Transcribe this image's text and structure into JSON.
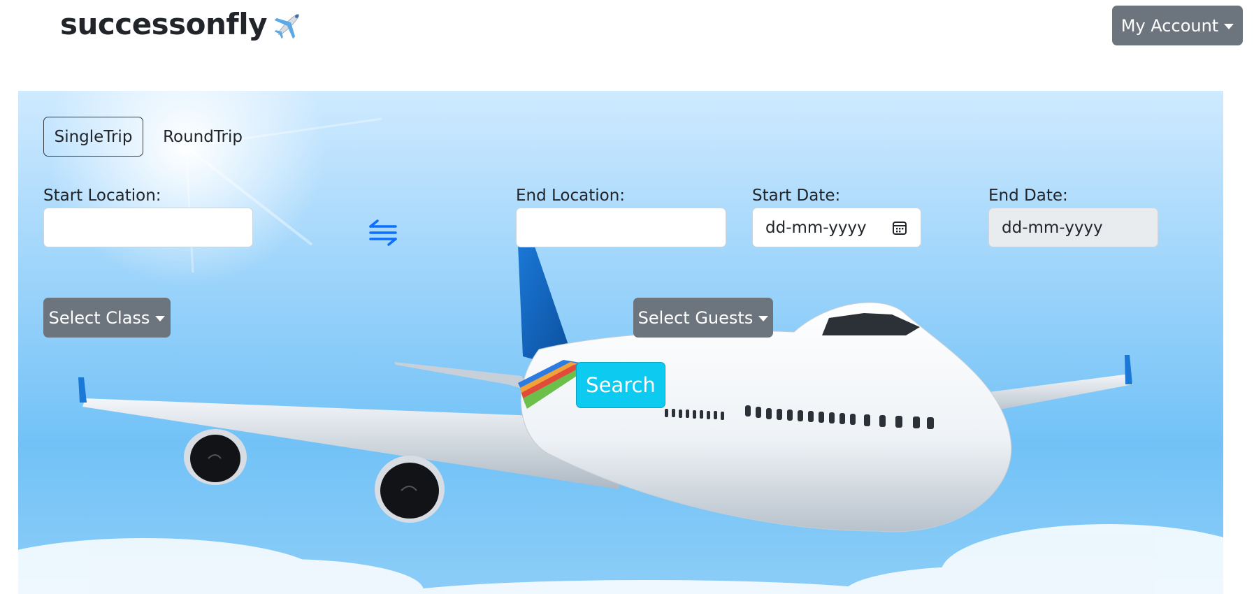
{
  "header": {
    "brand": "successonfly",
    "brand_icon": "airplane-icon",
    "account_label": "My Account"
  },
  "trip_tabs": {
    "single": "SingleTrip",
    "round": "RoundTrip",
    "selected": "SingleTrip"
  },
  "form": {
    "start_location": {
      "label": "Start Location:",
      "value": ""
    },
    "end_location": {
      "label": "End Location:",
      "value": ""
    },
    "start_date": {
      "label": "Start Date:",
      "value": "dd-mm-yyyy"
    },
    "end_date": {
      "label": "End Date:",
      "value": "dd-mm-yyyy"
    },
    "swap_icon": "swap-arrows-icon",
    "class_label": "Select Class",
    "guests_label": "Select Guests",
    "search_label": "Search"
  },
  "colors": {
    "secondary_button": "#6c757d",
    "search_button": "#0dcaf0",
    "swap_icon": "#0d6efd",
    "sky": "#72c2f7"
  }
}
